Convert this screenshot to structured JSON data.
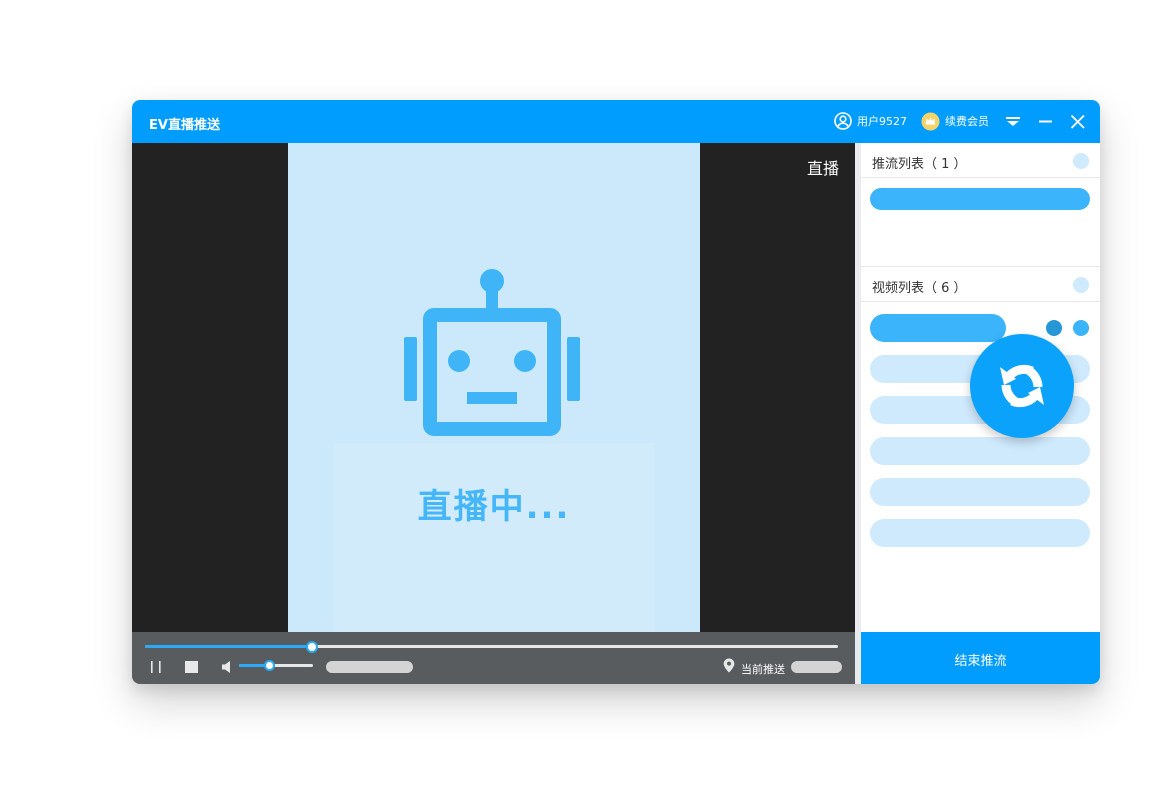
{
  "window": {
    "title": "EV直播推送"
  },
  "header": {
    "user_icon": "user-circle-icon",
    "user_label": "用户9527",
    "vip_icon": "crown-badge-icon",
    "vip_label": "续费会员",
    "menu_icon": "dropdown-menu-icon",
    "minimize_icon": "minimize-icon",
    "close_icon": "close-icon"
  },
  "video": {
    "status_tag": "直播",
    "status_text": "直播中...",
    "placeholder_icon": "robot-icon"
  },
  "player": {
    "progress": 0.24,
    "volume": 0.39,
    "pause_icon": "pause-icon",
    "stop_icon": "stop-icon",
    "volume_icon": "speaker-icon",
    "location_icon": "location-pin-icon",
    "location_label": "当前推送"
  },
  "panel": {
    "push_list_title": "推流列表（ 1 ）",
    "video_list_title": "视频列表（ 6 ）",
    "refresh_icon": "refresh-icon",
    "end_button": "结束推流"
  },
  "colors": {
    "brand": "#009dff",
    "accent": "#3cb4fc",
    "light_accent": "#cfeafd",
    "stage_bg": "#cce9fb",
    "video_bg": "#222222",
    "controls_bg": "#585c5f"
  }
}
